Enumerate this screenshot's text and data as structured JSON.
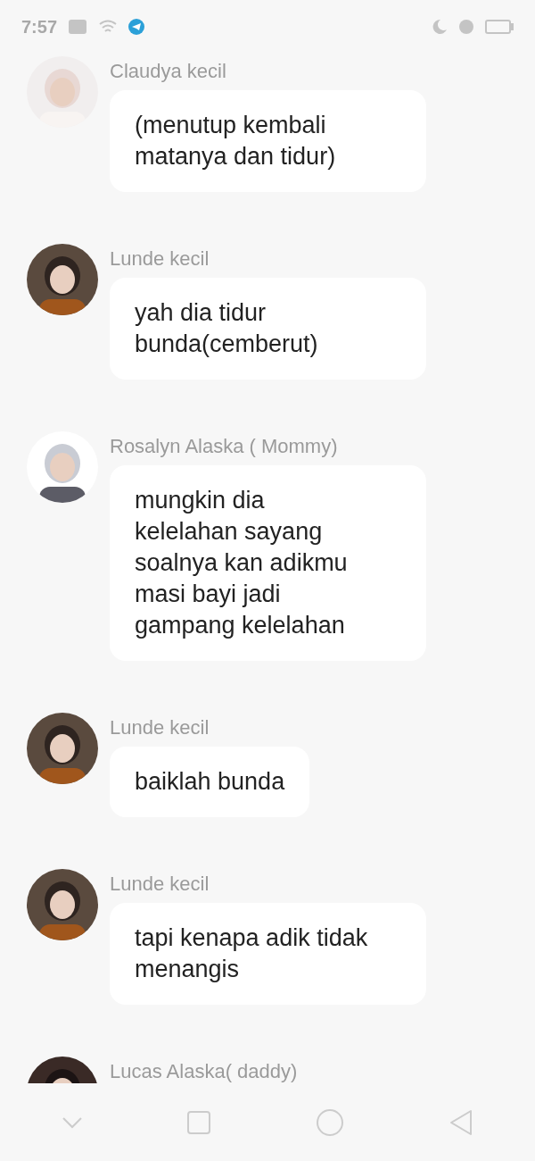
{
  "status_bar": {
    "time": "7:57"
  },
  "messages": [
    {
      "sender": "Claudya kecil",
      "lines": [
        "(menutup kembali",
        "matanya dan tidur)"
      ]
    },
    {
      "sender": "Lunde kecil",
      "lines": [
        "yah dia tidur",
        "bunda(cemberut)"
      ]
    },
    {
      "sender": "Rosalyn Alaska ( Mommy)",
      "lines": [
        "mungkin dia",
        "kelelahan sayang",
        "soalnya kan adikmu",
        "masi bayi jadi",
        "gampang kelelahan"
      ]
    },
    {
      "sender": "Lunde kecil",
      "lines": [
        "baiklah bunda"
      ]
    },
    {
      "sender": "Lunde kecil",
      "lines": [
        "tapi kenapa adik tidak",
        "menangis"
      ]
    },
    {
      "sender": "Lucas Alaska( daddy)"
    }
  ]
}
